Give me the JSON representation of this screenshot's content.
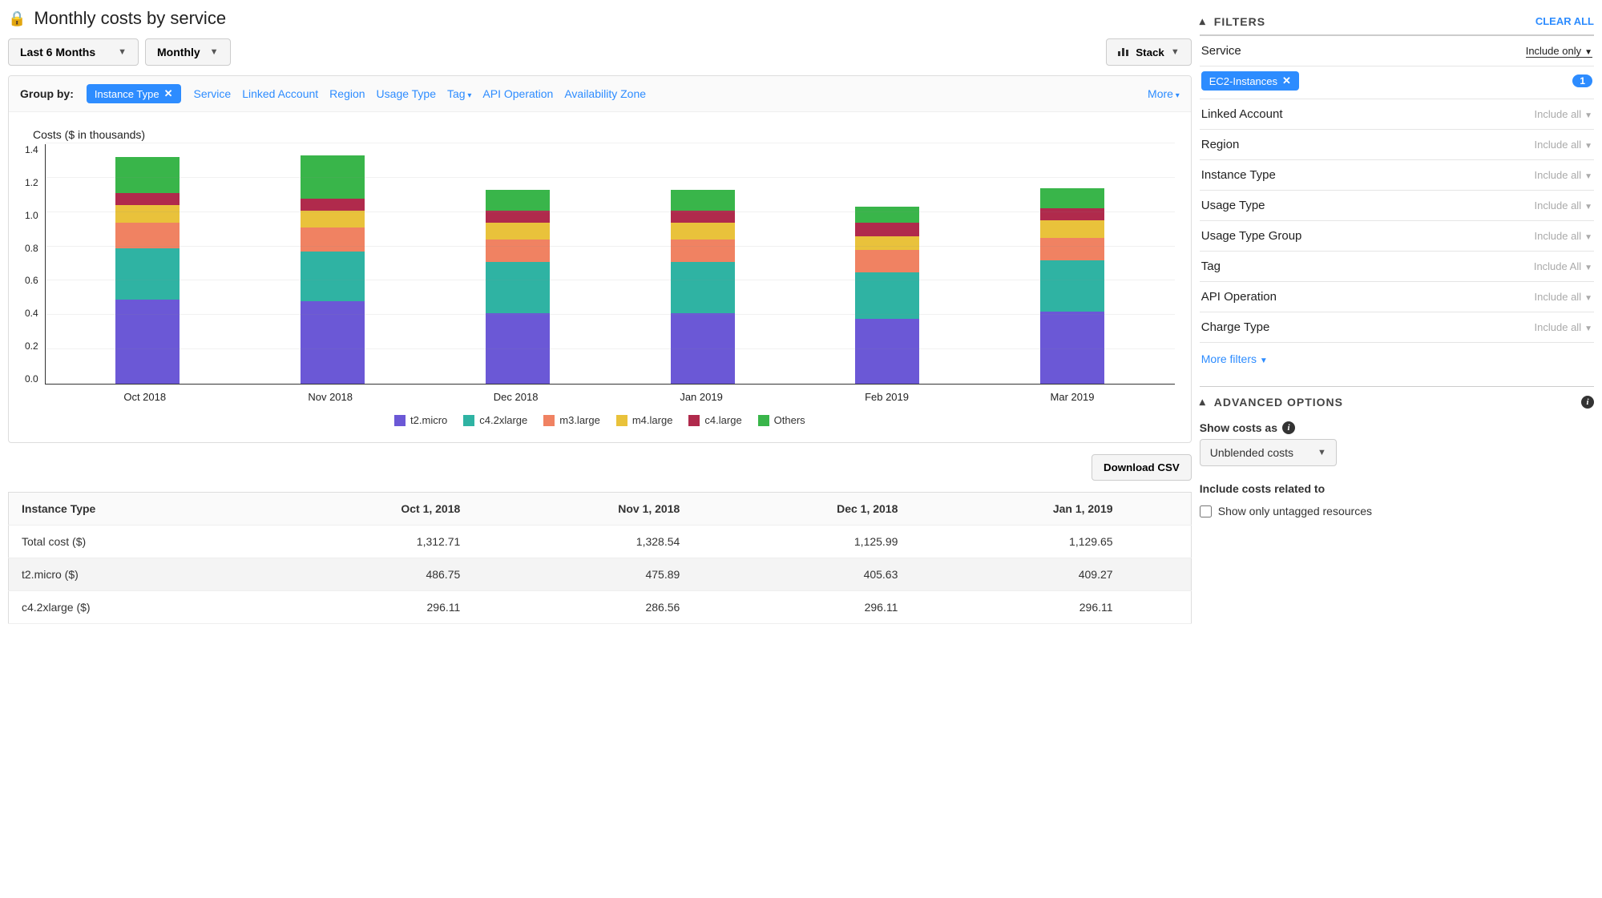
{
  "header": {
    "title": "Monthly costs by service",
    "timerange": "Last 6 Months",
    "granularity": "Monthly",
    "stack_label": "Stack"
  },
  "group_by": {
    "label": "Group by:",
    "active_chip": "Instance Type",
    "options": [
      "Service",
      "Linked Account",
      "Region",
      "Usage Type",
      "Tag",
      "API Operation",
      "Availability Zone"
    ],
    "more_label": "More"
  },
  "chart_data": {
    "type": "bar",
    "stacked": true,
    "title": "Costs ($ in thousands)",
    "ylim": [
      0.0,
      1.4
    ],
    "yticks": [
      0.0,
      0.2,
      0.4,
      0.6,
      0.8,
      1.0,
      1.2,
      1.4
    ],
    "categories": [
      "Oct 2018",
      "Nov 2018",
      "Dec 2018",
      "Jan 2019",
      "Feb 2019",
      "Mar 2019"
    ],
    "series": [
      {
        "name": "t2.micro",
        "color": "#6b58d6",
        "values": [
          0.49,
          0.48,
          0.41,
          0.41,
          0.38,
          0.42
        ]
      },
      {
        "name": "c4.2xlarge",
        "color": "#2fb3a3",
        "values": [
          0.3,
          0.29,
          0.3,
          0.3,
          0.27,
          0.3
        ]
      },
      {
        "name": "m3.large",
        "color": "#f08262",
        "values": [
          0.15,
          0.14,
          0.13,
          0.13,
          0.13,
          0.13
        ]
      },
      {
        "name": "m4.large",
        "color": "#e9c23b",
        "values": [
          0.1,
          0.1,
          0.1,
          0.1,
          0.08,
          0.1
        ]
      },
      {
        "name": "c4.large",
        "color": "#b02a4c",
        "values": [
          0.07,
          0.07,
          0.07,
          0.07,
          0.08,
          0.07
        ]
      },
      {
        "name": "Others",
        "color": "#39b54a",
        "values": [
          0.21,
          0.25,
          0.12,
          0.12,
          0.09,
          0.12
        ]
      }
    ]
  },
  "download_label": "Download CSV",
  "table": {
    "columns": [
      "Instance Type",
      "Oct 1, 2018",
      "Nov 1, 2018",
      "Dec 1, 2018",
      "Jan 1, 2019"
    ],
    "rows": [
      {
        "label": "Total cost ($)",
        "values": [
          "1,312.71",
          "1,328.54",
          "1,125.99",
          "1,129.65"
        ]
      },
      {
        "label": "t2.micro ($)",
        "values": [
          "486.75",
          "475.89",
          "405.63",
          "409.27"
        ]
      },
      {
        "label": "c4.2xlarge ($)",
        "values": [
          "296.11",
          "286.56",
          "296.11",
          "296.11"
        ]
      }
    ]
  },
  "filters": {
    "heading": "FILTERS",
    "clear_label": "CLEAR ALL",
    "rows": [
      {
        "name": "Service",
        "value": "Include only",
        "active": true,
        "chip": "EC2-Instances",
        "count": "1"
      },
      {
        "name": "Linked Account",
        "value": "Include all"
      },
      {
        "name": "Region",
        "value": "Include all"
      },
      {
        "name": "Instance Type",
        "value": "Include all"
      },
      {
        "name": "Usage Type",
        "value": "Include all"
      },
      {
        "name": "Usage Type Group",
        "value": "Include all"
      },
      {
        "name": "Tag",
        "value": "Include All"
      },
      {
        "name": "API Operation",
        "value": "Include all"
      },
      {
        "name": "Charge Type",
        "value": "Include all"
      }
    ],
    "more_label": "More filters"
  },
  "advanced": {
    "heading": "ADVANCED OPTIONS",
    "show_costs_label": "Show costs as",
    "cost_type": "Unblended costs",
    "include_label": "Include costs related to",
    "checkbox_label": "Show only untagged resources"
  }
}
